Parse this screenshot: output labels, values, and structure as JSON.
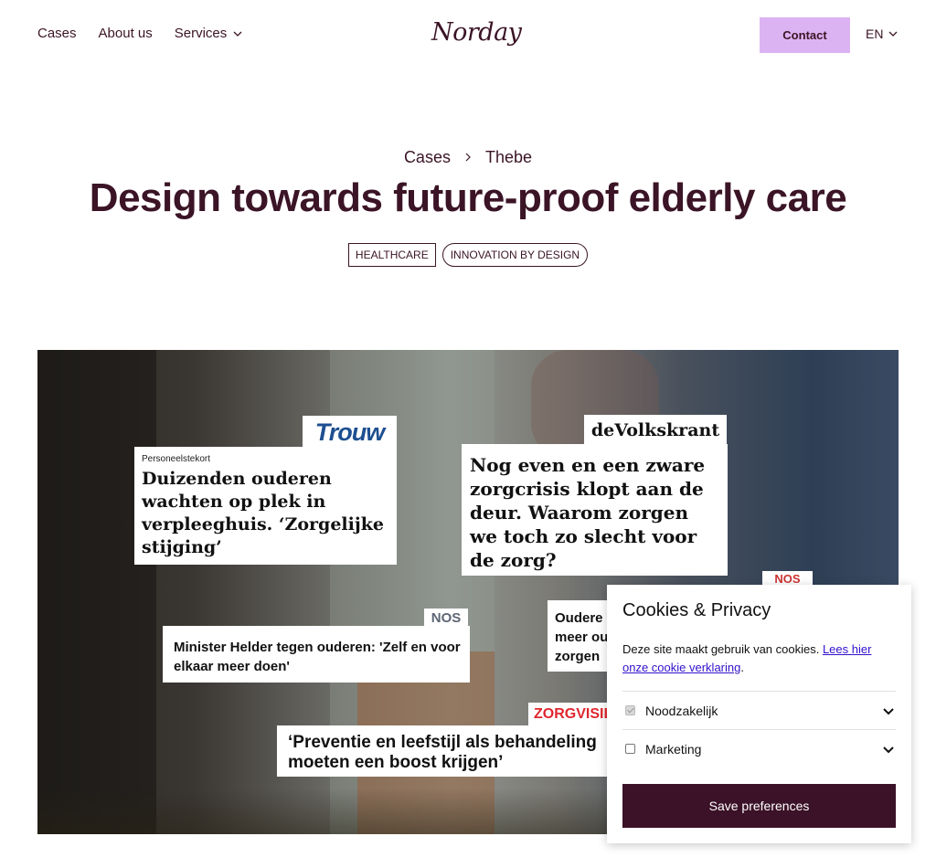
{
  "header": {
    "nav": [
      {
        "label": "Cases"
      },
      {
        "label": "About us"
      },
      {
        "label": "Services"
      }
    ],
    "logo": "Norday",
    "contact_label": "Contact",
    "language": "EN"
  },
  "hero": {
    "breadcrumb": [
      "Cases",
      "Thebe"
    ],
    "title": "Design towards future-proof elderly care",
    "tags": [
      "HEALTHCARE",
      "INNOVATION BY DESIGN"
    ]
  },
  "clippings": {
    "trouw": {
      "source": "Trouw",
      "kicker": "Personeelstekort",
      "headline": "Duizenden ouderen wachten op plek in verpleeghuis. ‘Zorgelijke stijging’"
    },
    "volkskrant": {
      "source": "deVolkskrant",
      "headline": "Nog even en een zware zorgcrisis klopt aan de deur. Waarom zorgen we toch zo slecht voor de zorg?"
    },
    "nos1": {
      "source": "NOS",
      "headline": "Minister Helder tegen ouderen: 'Zelf en voor elkaar meer doen'"
    },
    "nos2": {
      "source": "NOS",
      "lines": [
        "Oudere",
        "meer ou",
        "zorgen"
      ]
    },
    "zorgvisie": {
      "source": "ZORGVISIE",
      "lines": [
        "‘Preventie en leefstijl als behandeling",
        "moeten een boost krijgen’"
      ]
    }
  },
  "cookie": {
    "title": "Cookies & Privacy",
    "text": "Deze site maakt gebruik van cookies.",
    "link": "Lees hier onze cookie verklaring",
    "after_link": ".",
    "options": [
      {
        "label": "Noodzakelijk",
        "checked": true
      },
      {
        "label": "Marketing",
        "checked": false
      }
    ],
    "save_label": "Save preferences"
  },
  "colors": {
    "brand": "#3b1426",
    "contact_bg": "#dcb3f2",
    "save_bg": "#3c1228",
    "link": "#3311cc"
  }
}
